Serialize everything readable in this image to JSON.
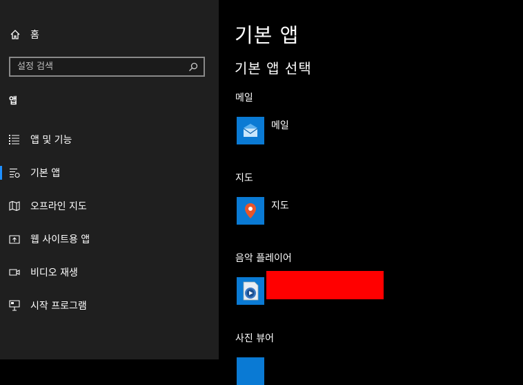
{
  "sidebar": {
    "home_label": "홈",
    "search_placeholder": "설정 검색",
    "section_title": "앱",
    "items": [
      {
        "label": "앱 및 기능",
        "icon": "list-icon"
      },
      {
        "label": "기본 앱",
        "icon": "default-apps-icon",
        "active": true
      },
      {
        "label": "오프라인 지도",
        "icon": "map-icon"
      },
      {
        "label": "웹 사이트용 앱",
        "icon": "open-external-icon"
      },
      {
        "label": "비디오 재생",
        "icon": "video-icon"
      },
      {
        "label": "시작 프로그램",
        "icon": "startup-icon"
      }
    ]
  },
  "main": {
    "title": "기본 앱",
    "subtitle": "기본 앱 선택",
    "categories": [
      {
        "label": "메일",
        "app": "메일",
        "icon": "mail-icon"
      },
      {
        "label": "지도",
        "app": "지도",
        "icon": "map-pin-icon"
      },
      {
        "label": "음악 플레이어",
        "app": "",
        "icon": "media-player-icon"
      },
      {
        "label": "사진 뷰어",
        "app": "",
        "icon": "photos-icon"
      }
    ]
  },
  "colors": {
    "accent": "#0a7ad4",
    "sidebar_bg": "#1f1f1f",
    "active_indicator": "#1e90ff",
    "redaction": "#ff0000"
  }
}
